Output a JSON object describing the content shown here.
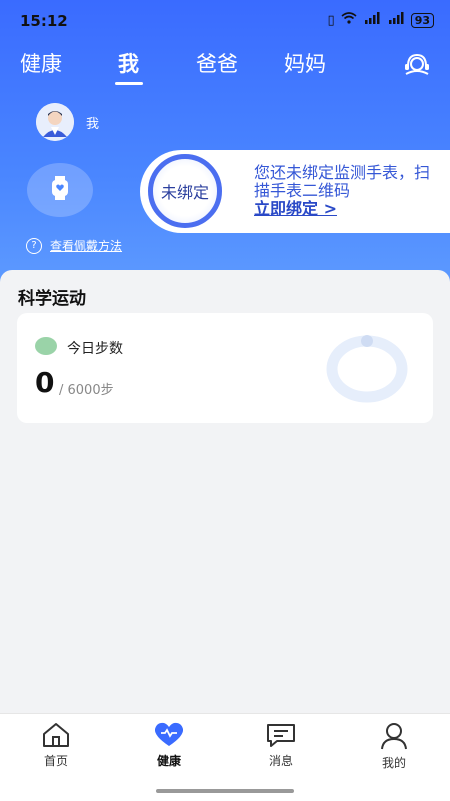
{
  "status_bar": {
    "time": "15:12",
    "icons": [
      "vibrate-icon",
      "wifi-icon",
      "5g-signal-icon",
      "5g-signal-icon"
    ],
    "battery": "93"
  },
  "tabs": [
    {
      "label": "健康",
      "active": false
    },
    {
      "label": "我",
      "active": true
    },
    {
      "label": "爸爸",
      "active": false
    },
    {
      "label": "妈妈",
      "active": false
    }
  ],
  "header": {
    "support_icon": "headset-icon"
  },
  "user": {
    "name": "我",
    "avatar_icon": "avatar-doctor"
  },
  "device": {
    "watch_icon": "watch-icon",
    "status_ring": "未绑定",
    "message": "您还未绑定监测手表，扫描手表二维码",
    "action": "立即绑定 >"
  },
  "help": {
    "label": "查看佩戴方法",
    "icon": "question-icon"
  },
  "sport": {
    "title": "科学运动",
    "steps_label": "今日步数",
    "steps_value": "0",
    "steps_goal": "/ 6000步",
    "progress": 0
  },
  "colors": {
    "accent": "#3a6bff",
    "ring": "#e6eefb",
    "ring_dot": "#cfdcf3"
  },
  "bottom_nav": [
    {
      "label": "首页",
      "icon": "home-icon",
      "active": false
    },
    {
      "label": "健康",
      "icon": "heart-icon",
      "active": true
    },
    {
      "label": "消息",
      "icon": "message-icon",
      "active": false
    },
    {
      "label": "我的",
      "icon": "person-icon",
      "active": false
    }
  ]
}
